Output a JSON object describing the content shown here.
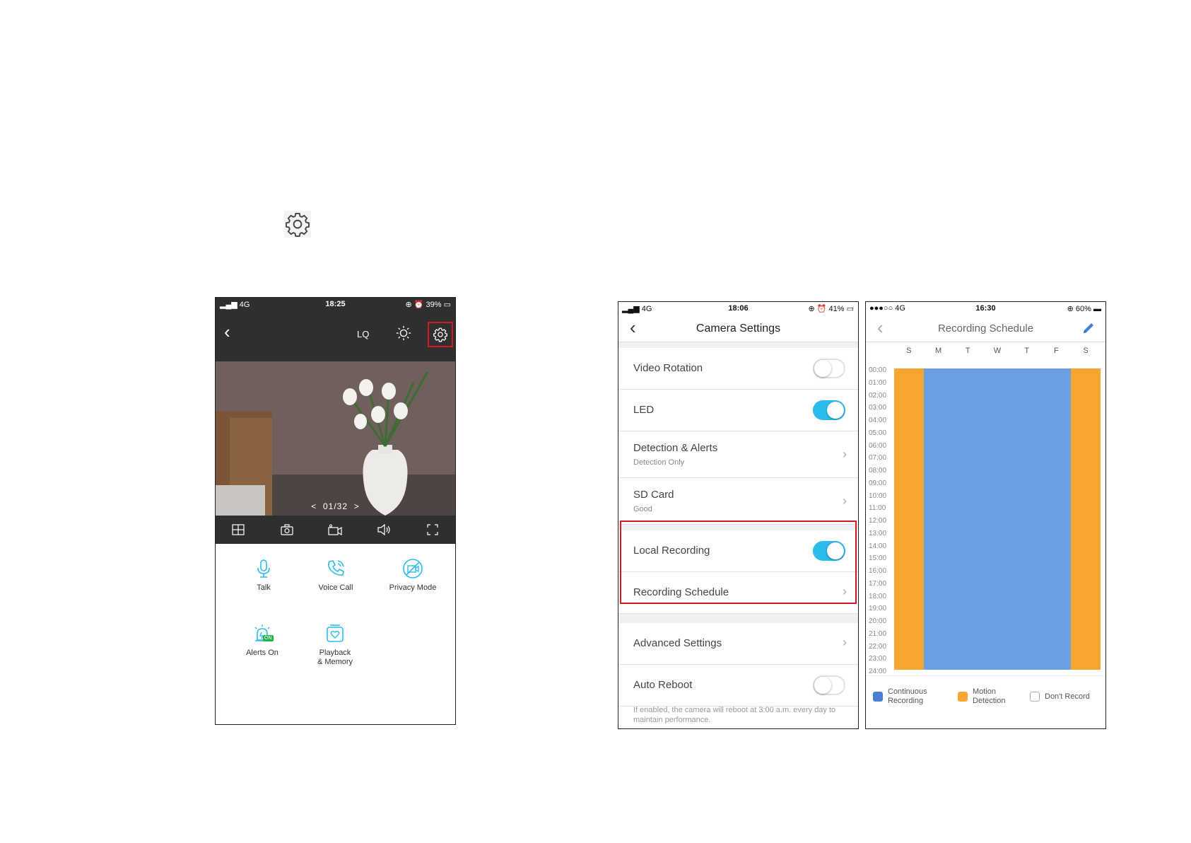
{
  "phone1": {
    "status": {
      "signal": "4G",
      "time": "18:25",
      "battery": "39%"
    },
    "nav": {
      "quality_label": "LQ"
    },
    "video": {
      "page_indicator": "01/32",
      "prev": "<",
      "next": ">"
    },
    "features": [
      {
        "label": "Talk",
        "icon": "microphone-icon"
      },
      {
        "label": "Voice Call",
        "icon": "phone-call-icon"
      },
      {
        "label": "Privacy Mode",
        "icon": "privacy-camera-off-icon"
      },
      {
        "label": "Alerts On",
        "icon": "alarm-on-icon",
        "badge": "ON"
      },
      {
        "label": "Playback\n& Memory",
        "icon": "playback-memory-icon"
      }
    ],
    "accent_color": "#2bbcee",
    "highlight_color": "#d01b25"
  },
  "phone2": {
    "status": {
      "signal": "4G",
      "time": "18:06",
      "battery": "41%"
    },
    "title": "Camera Settings",
    "rows": [
      {
        "label": "Video Rotation",
        "toggle": false
      },
      {
        "label": "LED",
        "toggle": true
      },
      {
        "label": "Detection & Alerts",
        "sub": "Detection Only"
      },
      {
        "label": "SD Card",
        "sub": "Good"
      },
      {
        "label": "Local Recording",
        "toggle": true
      },
      {
        "label": "Recording Schedule"
      },
      {
        "label": "Advanced Settings"
      },
      {
        "label": "Auto Reboot",
        "toggle": false
      }
    ],
    "footnote": "If enabled, the camera will reboot at 3:00 a.m. every day to maintain performance."
  },
  "phone3": {
    "status": {
      "signal": "4G",
      "time": "16:30",
      "battery": "60%"
    },
    "title": "Recording Schedule",
    "days": [
      "S",
      "M",
      "T",
      "W",
      "T",
      "F",
      "S"
    ],
    "hours": [
      "00:00",
      "01:00",
      "02:00",
      "03:00",
      "04:00",
      "05:00",
      "06:00",
      "07:00",
      "08:00",
      "09:00",
      "10:00",
      "11:00",
      "12:00",
      "13:00",
      "14:00",
      "15:00",
      "16:00",
      "17:00",
      "18:00",
      "19:00",
      "20:00",
      "21:00",
      "22:00",
      "23:00",
      "24:00"
    ],
    "day_modes": [
      "motion",
      "continuous",
      "continuous",
      "continuous",
      "continuous",
      "continuous",
      "motion"
    ],
    "legend": {
      "continuous": "Continuous\nRecording",
      "motion": "Motion\nDetection",
      "none": "Don't Record"
    },
    "colors": {
      "continuous": "#6a9fe4",
      "motion": "#f7a631"
    }
  }
}
